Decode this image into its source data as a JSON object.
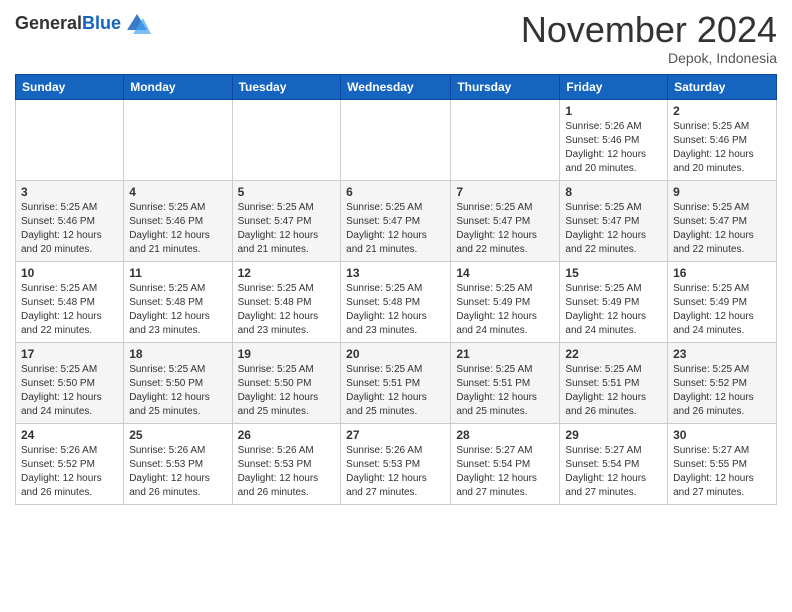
{
  "header": {
    "logo_general": "General",
    "logo_blue": "Blue",
    "month_title": "November 2024",
    "location": "Depok, Indonesia"
  },
  "weekdays": [
    "Sunday",
    "Monday",
    "Tuesday",
    "Wednesday",
    "Thursday",
    "Friday",
    "Saturday"
  ],
  "weeks": [
    [
      {
        "day": "",
        "info": ""
      },
      {
        "day": "",
        "info": ""
      },
      {
        "day": "",
        "info": ""
      },
      {
        "day": "",
        "info": ""
      },
      {
        "day": "",
        "info": ""
      },
      {
        "day": "1",
        "info": "Sunrise: 5:26 AM\nSunset: 5:46 PM\nDaylight: 12 hours\nand 20 minutes."
      },
      {
        "day": "2",
        "info": "Sunrise: 5:25 AM\nSunset: 5:46 PM\nDaylight: 12 hours\nand 20 minutes."
      }
    ],
    [
      {
        "day": "3",
        "info": "Sunrise: 5:25 AM\nSunset: 5:46 PM\nDaylight: 12 hours\nand 20 minutes."
      },
      {
        "day": "4",
        "info": "Sunrise: 5:25 AM\nSunset: 5:46 PM\nDaylight: 12 hours\nand 21 minutes."
      },
      {
        "day": "5",
        "info": "Sunrise: 5:25 AM\nSunset: 5:47 PM\nDaylight: 12 hours\nand 21 minutes."
      },
      {
        "day": "6",
        "info": "Sunrise: 5:25 AM\nSunset: 5:47 PM\nDaylight: 12 hours\nand 21 minutes."
      },
      {
        "day": "7",
        "info": "Sunrise: 5:25 AM\nSunset: 5:47 PM\nDaylight: 12 hours\nand 22 minutes."
      },
      {
        "day": "8",
        "info": "Sunrise: 5:25 AM\nSunset: 5:47 PM\nDaylight: 12 hours\nand 22 minutes."
      },
      {
        "day": "9",
        "info": "Sunrise: 5:25 AM\nSunset: 5:47 PM\nDaylight: 12 hours\nand 22 minutes."
      }
    ],
    [
      {
        "day": "10",
        "info": "Sunrise: 5:25 AM\nSunset: 5:48 PM\nDaylight: 12 hours\nand 22 minutes."
      },
      {
        "day": "11",
        "info": "Sunrise: 5:25 AM\nSunset: 5:48 PM\nDaylight: 12 hours\nand 23 minutes."
      },
      {
        "day": "12",
        "info": "Sunrise: 5:25 AM\nSunset: 5:48 PM\nDaylight: 12 hours\nand 23 minutes."
      },
      {
        "day": "13",
        "info": "Sunrise: 5:25 AM\nSunset: 5:48 PM\nDaylight: 12 hours\nand 23 minutes."
      },
      {
        "day": "14",
        "info": "Sunrise: 5:25 AM\nSunset: 5:49 PM\nDaylight: 12 hours\nand 24 minutes."
      },
      {
        "day": "15",
        "info": "Sunrise: 5:25 AM\nSunset: 5:49 PM\nDaylight: 12 hours\nand 24 minutes."
      },
      {
        "day": "16",
        "info": "Sunrise: 5:25 AM\nSunset: 5:49 PM\nDaylight: 12 hours\nand 24 minutes."
      }
    ],
    [
      {
        "day": "17",
        "info": "Sunrise: 5:25 AM\nSunset: 5:50 PM\nDaylight: 12 hours\nand 24 minutes."
      },
      {
        "day": "18",
        "info": "Sunrise: 5:25 AM\nSunset: 5:50 PM\nDaylight: 12 hours\nand 25 minutes."
      },
      {
        "day": "19",
        "info": "Sunrise: 5:25 AM\nSunset: 5:50 PM\nDaylight: 12 hours\nand 25 minutes."
      },
      {
        "day": "20",
        "info": "Sunrise: 5:25 AM\nSunset: 5:51 PM\nDaylight: 12 hours\nand 25 minutes."
      },
      {
        "day": "21",
        "info": "Sunrise: 5:25 AM\nSunset: 5:51 PM\nDaylight: 12 hours\nand 25 minutes."
      },
      {
        "day": "22",
        "info": "Sunrise: 5:25 AM\nSunset: 5:51 PM\nDaylight: 12 hours\nand 26 minutes."
      },
      {
        "day": "23",
        "info": "Sunrise: 5:25 AM\nSunset: 5:52 PM\nDaylight: 12 hours\nand 26 minutes."
      }
    ],
    [
      {
        "day": "24",
        "info": "Sunrise: 5:26 AM\nSunset: 5:52 PM\nDaylight: 12 hours\nand 26 minutes."
      },
      {
        "day": "25",
        "info": "Sunrise: 5:26 AM\nSunset: 5:53 PM\nDaylight: 12 hours\nand 26 minutes."
      },
      {
        "day": "26",
        "info": "Sunrise: 5:26 AM\nSunset: 5:53 PM\nDaylight: 12 hours\nand 26 minutes."
      },
      {
        "day": "27",
        "info": "Sunrise: 5:26 AM\nSunset: 5:53 PM\nDaylight: 12 hours\nand 27 minutes."
      },
      {
        "day": "28",
        "info": "Sunrise: 5:27 AM\nSunset: 5:54 PM\nDaylight: 12 hours\nand 27 minutes."
      },
      {
        "day": "29",
        "info": "Sunrise: 5:27 AM\nSunset: 5:54 PM\nDaylight: 12 hours\nand 27 minutes."
      },
      {
        "day": "30",
        "info": "Sunrise: 5:27 AM\nSunset: 5:55 PM\nDaylight: 12 hours\nand 27 minutes."
      }
    ]
  ]
}
